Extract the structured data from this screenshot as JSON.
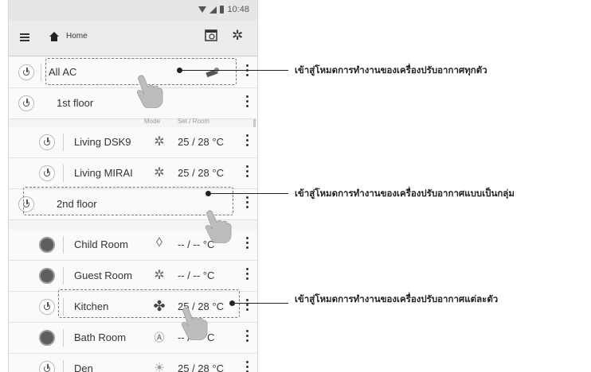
{
  "status_bar": {
    "time": "10:48"
  },
  "app_bar": {
    "title": "Home"
  },
  "column_headers": {
    "mode": "Mode",
    "set_room": "Set / Room"
  },
  "rows": [
    {
      "label": "All AC",
      "power": "off",
      "mode_icon": "remote-icon",
      "temp": ""
    },
    {
      "label": "1st floor",
      "power": "off",
      "mode_icon": "",
      "temp": ""
    },
    {
      "label": "Living DSK9",
      "power": "off",
      "mode_icon": "snowflake-icon",
      "temp": "25 / 28 °C"
    },
    {
      "label": "Living MIRAI",
      "power": "off",
      "mode_icon": "snowflake-icon",
      "temp": "25 / 28 °C"
    },
    {
      "label": "2nd floor",
      "power": "off",
      "mode_icon": "",
      "temp": ""
    },
    {
      "label": "Child Room",
      "power": "on",
      "mode_icon": "droplet-icon",
      "temp": "-- / --  °C"
    },
    {
      "label": "Guest Room",
      "power": "on",
      "mode_icon": "snowflake-icon",
      "temp": "-- / --  °C"
    },
    {
      "label": "Kitchen",
      "power": "off",
      "mode_icon": "fan-icon",
      "temp": "25 / 28 °C"
    },
    {
      "label": "Bath Room",
      "power": "on",
      "mode_icon": "auto-mode-icon",
      "temp": "-- / --  °C"
    },
    {
      "label": "Den",
      "power": "off",
      "mode_icon": "sun-icon",
      "temp": "25 / 28 °C"
    }
  ],
  "annotations": [
    "เข้าสู่โหมดการทำงานของเครื่องปรับอากาศทุกตัว",
    "เข้าสู่โหมดการทำงานของเครื่องปรับอากาศแบบเป็นกลุ่ม",
    "เข้าสู่โหมดการทำงานของเครื่องปรับอากาศแต่ละตัว"
  ]
}
